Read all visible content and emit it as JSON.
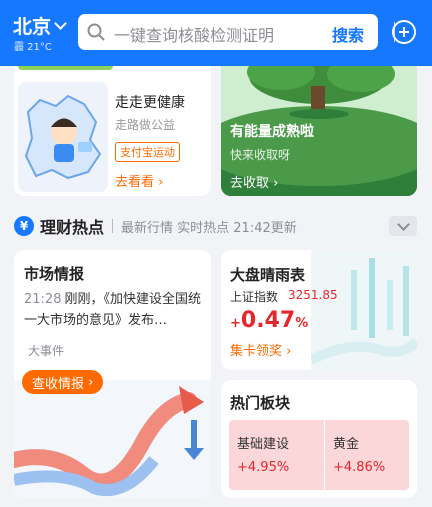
{
  "header": {
    "city": "北京",
    "weather": "霾 21°C",
    "search_placeholder": "一键查询核酸检测证明",
    "search_button": "搜索"
  },
  "walk_card": {
    "title": "走走更健康",
    "subtitle": "走路做公益",
    "tag": "支付宝运动",
    "action": "去看看"
  },
  "energy_card": {
    "title": "有能量成熟啦",
    "subtitle": "快来收取呀",
    "action": "去收取"
  },
  "finance_section": {
    "icon_glyph": "¥",
    "title": "理财热点",
    "subtitle": "最新行情 实时热点 21:42更新"
  },
  "market_card": {
    "title": "市场情报",
    "news_time": "21:28",
    "news_text": "刚刚，《加快建设全国统一大市场的意见》发布…",
    "category": "大事件",
    "action": "查收情报"
  },
  "index_card": {
    "title": "大盘晴雨表",
    "index_name": "上证指数",
    "index_value": "3251.85",
    "change_sign": "+",
    "change_value": "0.47",
    "change_unit": "%",
    "action": "集卡领奖"
  },
  "hot_sectors": {
    "title": "热门板块",
    "items": [
      {
        "name": "基础建设",
        "change": "+4.95%"
      },
      {
        "name": "黄金",
        "change": "+4.86%"
      }
    ]
  },
  "colors": {
    "brand": "#1677ff",
    "accent_orange": "#ff6a00",
    "rise_red": "#e5262b"
  }
}
